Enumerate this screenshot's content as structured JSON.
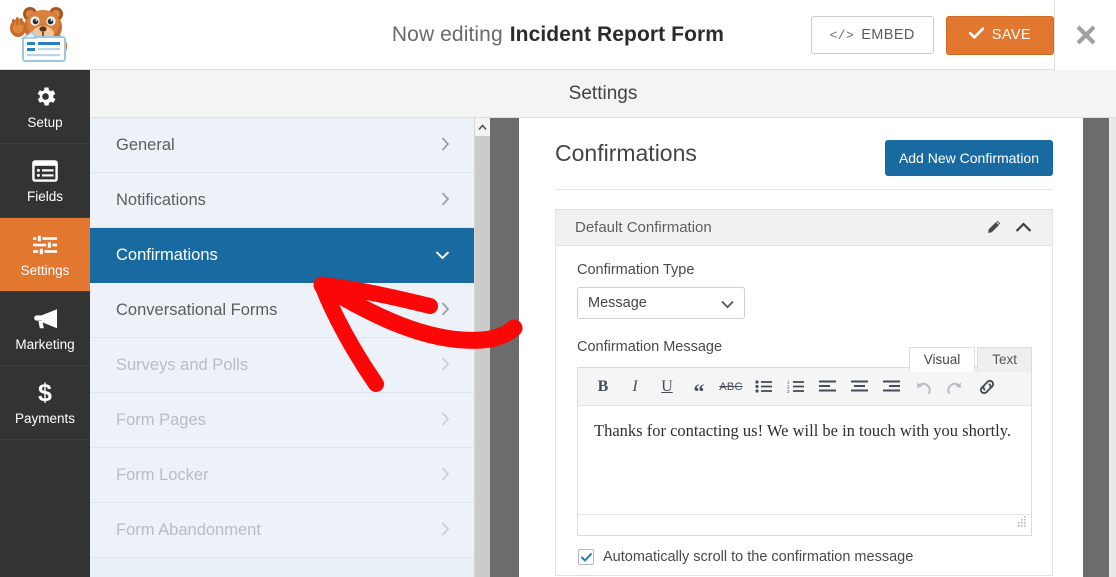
{
  "header": {
    "logo_icon": "wpforms-bear-mascot-logo",
    "editing_prefix": "Now editing",
    "form_name": "Incident Report Form",
    "embed_label": "EMBED",
    "embed_icon": "code-icon",
    "save_label": "SAVE",
    "save_icon": "checkmark-icon",
    "close_icon": "close-icon",
    "accent_orange": "#e27730",
    "accent_blue": "#1a6aa2"
  },
  "rail": {
    "items": [
      {
        "label": "Setup",
        "icon": "gear-icon",
        "active": false
      },
      {
        "label": "Fields",
        "icon": "list-icon",
        "active": false
      },
      {
        "label": "Settings",
        "icon": "sliders-icon",
        "active": true
      },
      {
        "label": "Marketing",
        "icon": "megaphone-icon",
        "active": false
      },
      {
        "label": "Payments",
        "icon": "dollar-icon",
        "active": false
      }
    ]
  },
  "settings_bar": {
    "title": "Settings"
  },
  "nav": {
    "items": [
      {
        "label": "General",
        "state": "normal",
        "chevron": "chevron-right-icon"
      },
      {
        "label": "Notifications",
        "state": "normal",
        "chevron": "chevron-right-icon"
      },
      {
        "label": "Confirmations",
        "state": "active",
        "chevron": "chevron-down-icon"
      },
      {
        "label": "Conversational Forms",
        "state": "normal",
        "chevron": "chevron-right-icon"
      },
      {
        "label": "Surveys and Polls",
        "state": "muted",
        "chevron": "chevron-right-icon"
      },
      {
        "label": "Form Pages",
        "state": "muted",
        "chevron": "chevron-right-icon"
      },
      {
        "label": "Form Locker",
        "state": "muted",
        "chevron": "chevron-right-icon"
      },
      {
        "label": "Form Abandonment",
        "state": "muted",
        "chevron": "chevron-right-icon"
      }
    ],
    "scrollbar_up_icon": "scroll-up-arrow-icon"
  },
  "content": {
    "title": "Confirmations",
    "add_button": "Add New Confirmation",
    "panel": {
      "title": "Default Confirmation",
      "edit_icon": "pencil-icon",
      "collapse_icon": "chevron-up-icon"
    },
    "confirmation_type": {
      "label": "Confirmation Type",
      "value": "Message",
      "chevron": "chevron-down-icon"
    },
    "confirmation_message": {
      "label": "Confirmation Message",
      "tabs": [
        {
          "label": "Visual",
          "active": true
        },
        {
          "label": "Text",
          "active": false
        }
      ],
      "toolbar": [
        {
          "name": "bold-icon",
          "glyph": "B",
          "enabled": true
        },
        {
          "name": "italic-icon",
          "glyph": "I",
          "enabled": true
        },
        {
          "name": "underline-icon",
          "glyph": "U",
          "enabled": true
        },
        {
          "name": "blockquote-icon",
          "glyph": "“",
          "enabled": true
        },
        {
          "name": "strikethrough-icon",
          "glyph": "ABC",
          "enabled": true
        },
        {
          "name": "bullet-list-icon",
          "glyph": "",
          "enabled": true
        },
        {
          "name": "numbered-list-icon",
          "glyph": "",
          "enabled": true
        },
        {
          "name": "align-left-icon",
          "glyph": "",
          "enabled": true
        },
        {
          "name": "align-center-icon",
          "glyph": "",
          "enabled": true
        },
        {
          "name": "align-right-icon",
          "glyph": "",
          "enabled": true
        },
        {
          "name": "undo-icon",
          "glyph": "",
          "enabled": false
        },
        {
          "name": "redo-icon",
          "glyph": "",
          "enabled": false
        },
        {
          "name": "link-icon",
          "glyph": "",
          "enabled": true
        }
      ],
      "body_text": "Thanks for contacting us! We will be in touch with you shortly.",
      "resize_handle_icon": "resize-grip-icon"
    },
    "auto_scroll": {
      "label": "Automatically scroll to the confirmation message",
      "checked": true,
      "check_icon": "checkmark-icon"
    }
  },
  "annotation": {
    "name": "red-arrow-annotation",
    "color": "#fb0707"
  }
}
